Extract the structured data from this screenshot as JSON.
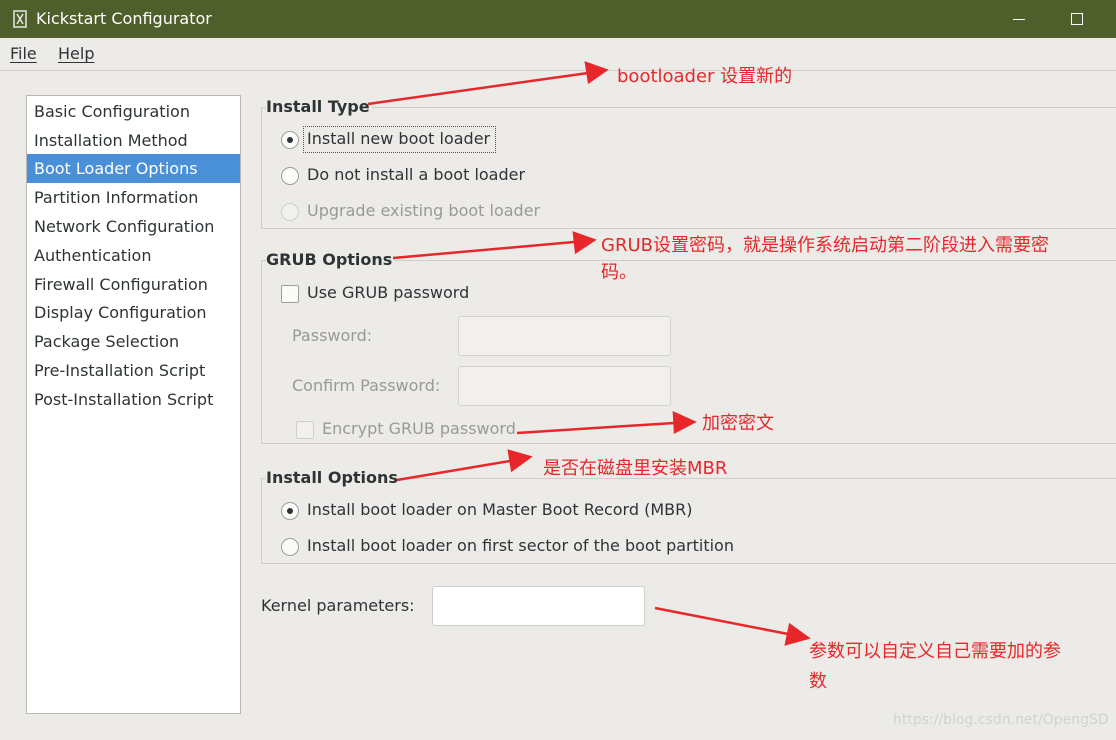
{
  "window": {
    "title": "Kickstart Configurator"
  },
  "menu": {
    "file": "File",
    "help": "Help"
  },
  "sidebar": {
    "items": [
      {
        "label": "Basic Configuration",
        "selected": false
      },
      {
        "label": "Installation Method",
        "selected": false
      },
      {
        "label": "Boot Loader Options",
        "selected": true
      },
      {
        "label": "Partition Information",
        "selected": false
      },
      {
        "label": "Network Configuration",
        "selected": false
      },
      {
        "label": "Authentication",
        "selected": false
      },
      {
        "label": "Firewall Configuration",
        "selected": false
      },
      {
        "label": "Display Configuration",
        "selected": false
      },
      {
        "label": "Package Selection",
        "selected": false
      },
      {
        "label": "Pre-Installation Script",
        "selected": false
      },
      {
        "label": "Post-Installation Script",
        "selected": false
      }
    ]
  },
  "install_type": {
    "title": "Install Type",
    "new_loader": "Install new boot loader",
    "no_loader": "Do not install a boot loader",
    "upgrade": "Upgrade existing boot loader",
    "selected": "new_loader"
  },
  "grub_options": {
    "title": "GRUB Options",
    "use_password": "Use GRUB password",
    "use_password_checked": false,
    "password_label": "Password:",
    "password_value": "",
    "confirm_label": "Confirm Password:",
    "confirm_value": "",
    "encrypt": "Encrypt GRUB password",
    "encrypt_checked": false
  },
  "install_options": {
    "title": "Install Options",
    "mbr": "Install boot loader on Master Boot Record (MBR)",
    "first_sector": "Install boot loader on first sector of the boot partition",
    "selected": "mbr"
  },
  "kernel": {
    "label": "Kernel parameters:",
    "value": ""
  },
  "annotations": {
    "bootloader": "bootloader 设置新的",
    "grub_line1": "GRUB设置密码，就是操作系统启动第二阶段进入需要密",
    "grub_line2": "码。",
    "encrypt": "加密密文",
    "mbr": "是否在磁盘里安装MBR",
    "kernel_line1": "参数可以自定义自己需要加的参",
    "kernel_line2": "数"
  },
  "watermark": "https://blog.csdn.net/OpengSD",
  "colors": {
    "titlebar": "#4f5f2b",
    "selection": "#4a90d9",
    "annotation": "#e8272b"
  }
}
